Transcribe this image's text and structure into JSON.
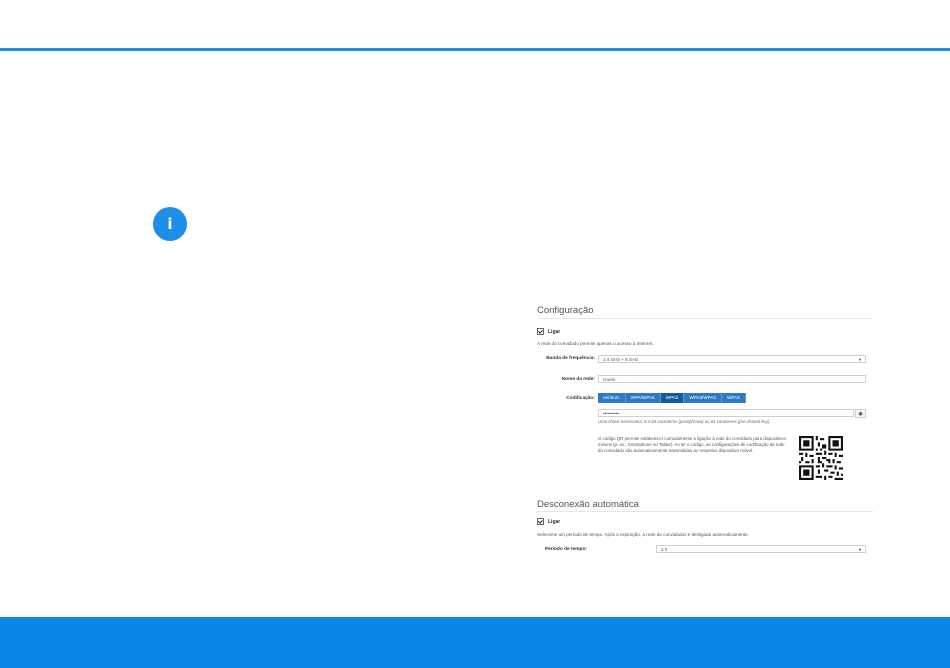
{
  "info_icon": {
    "glyph": "i",
    "name": "info-icon"
  },
  "configuration": {
    "title": "Configuração",
    "enable_label": "Ligar",
    "description": "A rede do convidado permite apenas o acesso à Internet.",
    "band_label": "Banda de frequência:",
    "band_value": "2,4 GHz + 5 GHz",
    "network_name_label": "Nome da rede:",
    "network_name_value": "Guest",
    "encryption_label": "Codificação:",
    "encryption_options": [
      "nenhum",
      "WPA/WPA2",
      "WPA2",
      "WPA3/WPA2",
      "WPA3"
    ],
    "encryption_selected": "WPA2",
    "password_value": "••••••••••",
    "password_hint": "Uma chave necessária: 8 a 63 caracteres (passphrase) ou 64 caracteres (pre-shared key)",
    "qr_description": "O código QR permite estabelecer comodamente a ligação à rede do convidado para dispositivos móveis (p. ex., Smartphone ou Tablet). Ao ler o código, as configurações de codificação da rede do convidado são automaticamente transmitidas ao respetivo dispositivo móvel."
  },
  "auto_disconnect": {
    "title": "Desconexão automática",
    "enable_label": "Ligar",
    "description": "Selecione um período de tempo. Após a expiração, a rede de convidados é desligada automaticamente.",
    "period_label": "Período de tempo:",
    "period_value": "2 h"
  },
  "colors": {
    "accent": "#1e8ee6",
    "footer": "#0a87e8",
    "segment": "#2c79c5",
    "segment_active": "#135a9e"
  }
}
